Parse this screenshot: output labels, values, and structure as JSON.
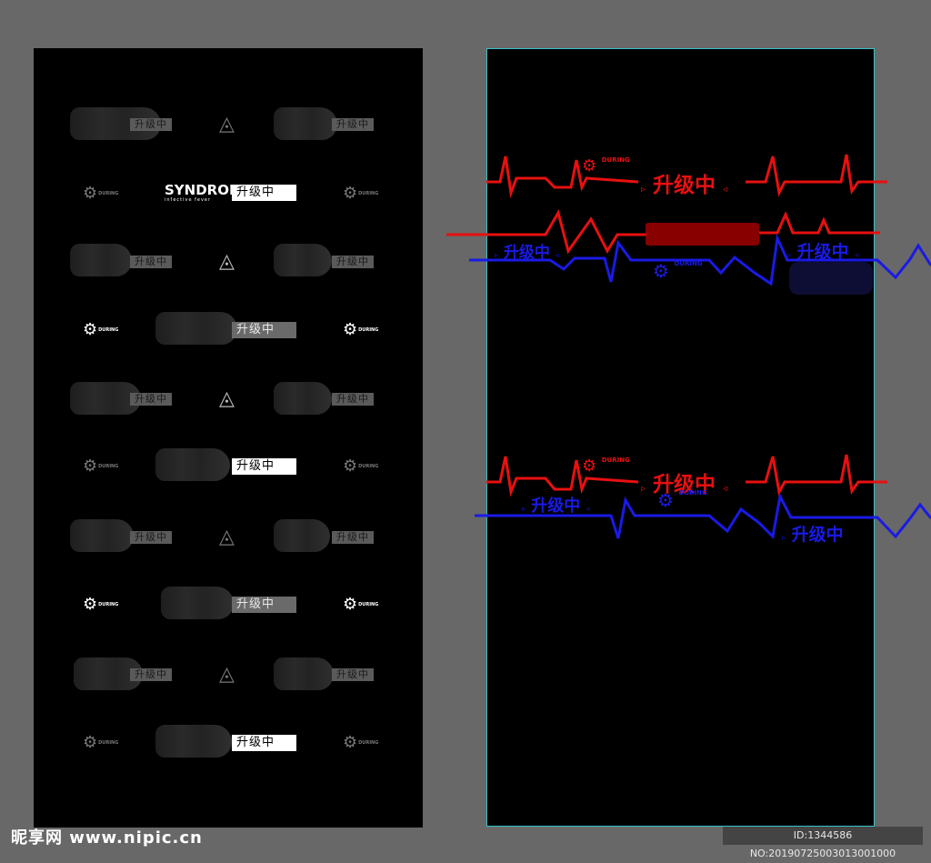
{
  "left_panel": {
    "syndrome": {
      "title": "SYNDROME",
      "subtitle": "infective fever"
    },
    "tag_label": "升级中",
    "gear_logo_text": "DURING",
    "gear_icon": "gear-icon",
    "triangle_icon": "triangle-logo-icon"
  },
  "right_panel": {
    "top_center_label": "升级中",
    "top_left_blue_label": "升级中",
    "top_right_blue_label": "升级中",
    "bottom_center_label": "升级中",
    "bottom_left_blue_label": "升级中",
    "bottom_right_blue_label": "升级中",
    "gear_logo_text": "DURING",
    "colors": {
      "red": "#e81010",
      "blue": "#1a1ae6",
      "border": "#35c3c8"
    }
  },
  "watermark": {
    "site": "昵享网 www.nipic.cn",
    "id_text": "ID:1344586 NO:20190725003013001000"
  }
}
